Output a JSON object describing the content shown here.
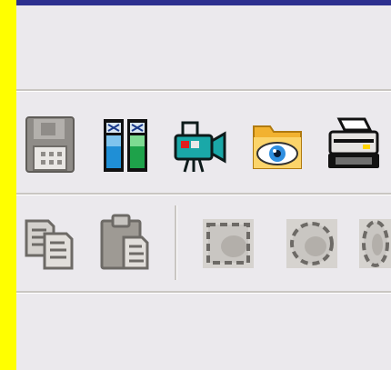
{
  "window": {
    "accent_color": "#2d2f8f",
    "side_stripe_color": "#ffff00"
  },
  "toolbar_top": {
    "buttons": [
      {
        "icon": "floppy-disk-icon",
        "state": "disabled"
      },
      {
        "icon": "compare-panels-icon",
        "state": "enabled"
      },
      {
        "icon": "video-camera-icon",
        "state": "enabled"
      },
      {
        "icon": "folder-eye-icon",
        "state": "enabled"
      },
      {
        "icon": "printer-icon",
        "state": "enabled"
      }
    ]
  },
  "toolbar_bottom": {
    "buttons": [
      {
        "icon": "copy-icon",
        "state": "disabled"
      },
      {
        "icon": "paste-icon",
        "state": "disabled"
      },
      {
        "icon": "rectangle-select-icon",
        "state": "disabled"
      },
      {
        "icon": "ellipse-select-icon",
        "state": "disabled"
      },
      {
        "icon": "lasso-select-icon",
        "state": "disabled"
      }
    ]
  }
}
